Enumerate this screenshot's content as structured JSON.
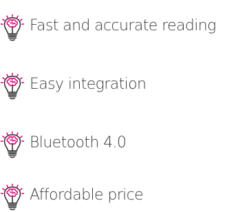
{
  "features": {
    "items": [
      {
        "label": "Fast and accurate reading",
        "icon": "lightbulb-brain-icon"
      },
      {
        "label": "Easy integration",
        "icon": "lightbulb-brain-icon"
      },
      {
        "label": "Bluetooth 4.0",
        "icon": "lightbulb-brain-icon"
      },
      {
        "label": "Affordable price",
        "icon": "lightbulb-brain-icon"
      }
    ],
    "colors": {
      "accent": "#e6007e",
      "outline": "#333333",
      "text": "#3a3a3a"
    }
  }
}
